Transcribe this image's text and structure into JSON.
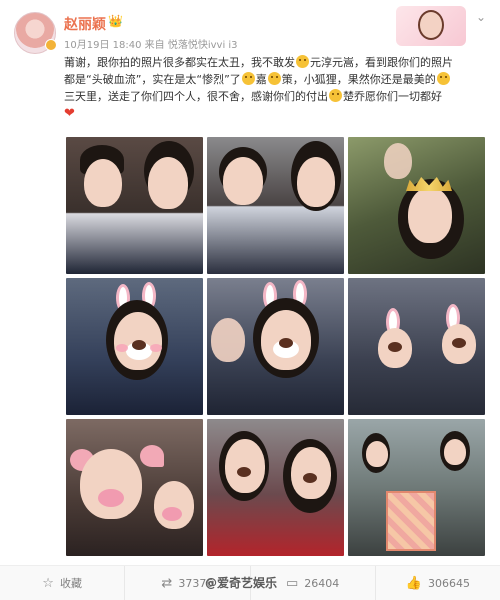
{
  "user": {
    "name": "赵丽颖",
    "vip_icon": "crown-icon",
    "time": "10月19日 18:40",
    "source_prefix": "来自",
    "source": "悦落悦快ivvi i3"
  },
  "post": {
    "line1": "莆谢，跟你拍的照片很多都实在太丑，我不敢发",
    "line1b": "元淳元嵩，看到跟你们的照片",
    "line2": "都是“头破血流”，实在是太“惨烈”了",
    "line2b": "嘉",
    "line2c": "策，小狐狸，果然你还是最美的",
    "line3": "三天里，送走了你们四个人，很不舍，感谢你们的付出",
    "line3b": "楚乔愿你们一切都好"
  },
  "photos": [
    {
      "label": "photo-1"
    },
    {
      "label": "photo-2"
    },
    {
      "label": "photo-3"
    },
    {
      "label": "photo-4"
    },
    {
      "label": "photo-5"
    },
    {
      "label": "photo-6"
    },
    {
      "label": "photo-7"
    },
    {
      "label": "photo-8"
    },
    {
      "label": "photo-9"
    }
  ],
  "actions": {
    "favorite_icon": "star-icon",
    "favorite_label": "收藏",
    "repost_icon": "repost-icon",
    "repost_count": "37376",
    "comment_icon": "comment-icon",
    "comment_count": "26404",
    "like_icon": "thumbs-up-icon",
    "like_count": "306645"
  },
  "watermark": "@爱奇艺娱乐"
}
